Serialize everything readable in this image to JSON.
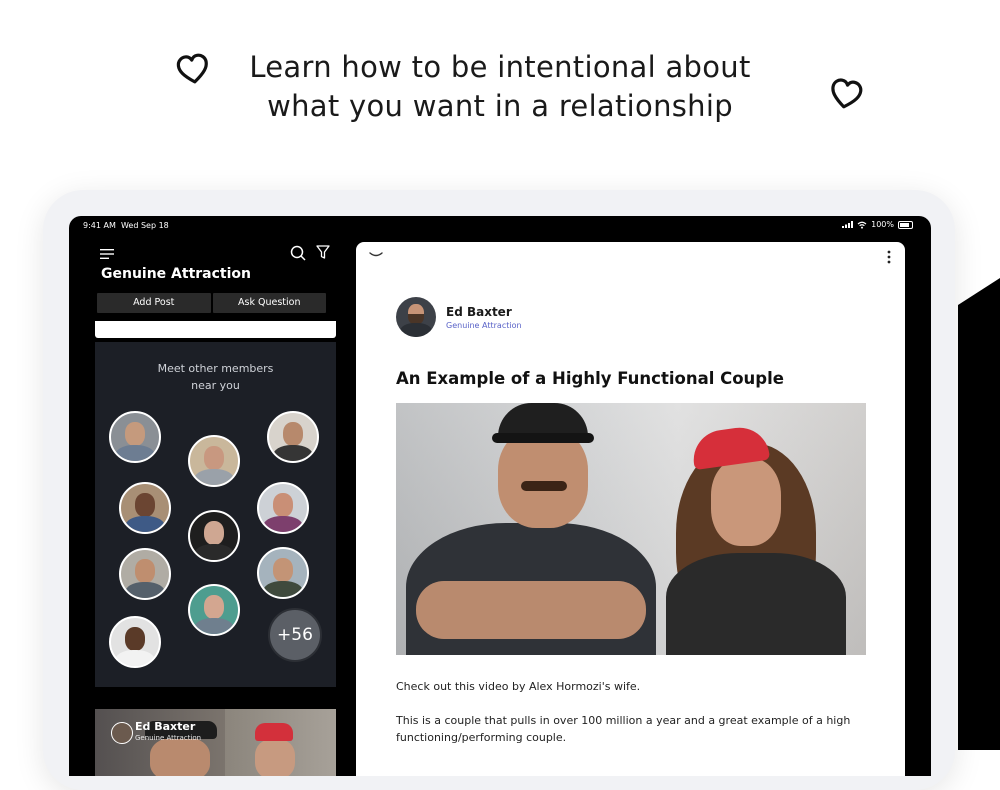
{
  "headline": {
    "line1": "Learn how to be intentional about",
    "line2": "what you want in a relationship"
  },
  "status_bar": {
    "time": "9:41 AM",
    "date": "Wed Sep 18",
    "battery": "100%"
  },
  "left_pane": {
    "title": "Genuine Attraction",
    "buttons": {
      "add_post": "Add Post",
      "ask_question": "Ask Question"
    },
    "members_title": "Meet other members\nnear you",
    "more_count": "+56",
    "preview": {
      "author": "Ed Baxter",
      "group": "Genuine Attraction"
    }
  },
  "post": {
    "author": "Ed Baxter",
    "group": "Genuine Attraction",
    "title": "An Example of a Highly Functional Couple",
    "text1": "Check out this video by Alex Hormozi's wife.",
    "text2": "This is a couple that pulls in over 100 million a year and a great example of a high functioning/performing couple."
  },
  "colors": {
    "accent_link": "#5a63c8",
    "members_panel": "#1c1f26",
    "screen_bg": "#000000"
  }
}
